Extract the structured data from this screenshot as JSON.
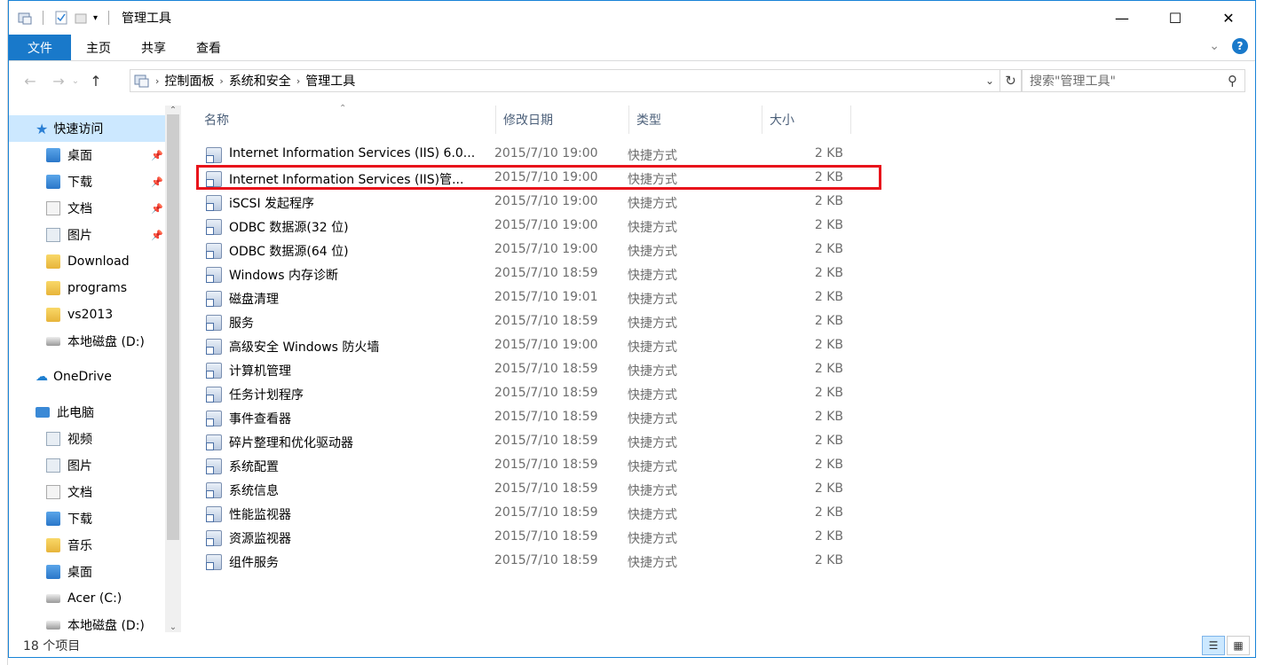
{
  "title": "管理工具",
  "ribbon": {
    "tabs": [
      "文件",
      "主页",
      "共享",
      "查看"
    ],
    "help_label": "?"
  },
  "address": {
    "crumbs": [
      "控制面板",
      "系统和安全",
      "管理工具"
    ]
  },
  "search": {
    "placeholder": "搜索\"管理工具\""
  },
  "nav": {
    "quick_access": "快速访问",
    "items": [
      {
        "label": "桌面",
        "pinned": true,
        "icon": "desktop-folder-icon"
      },
      {
        "label": "下载",
        "pinned": true,
        "icon": "downloads-folder-icon"
      },
      {
        "label": "文档",
        "pinned": true,
        "icon": "documents-folder-icon"
      },
      {
        "label": "图片",
        "pinned": true,
        "icon": "pictures-folder-icon"
      },
      {
        "label": "Download",
        "pinned": false,
        "icon": "folder-icon"
      },
      {
        "label": "programs",
        "pinned": false,
        "icon": "folder-icon"
      },
      {
        "label": "vs2013",
        "pinned": false,
        "icon": "folder-icon"
      },
      {
        "label": "本地磁盘 (D:)",
        "pinned": false,
        "icon": "drive-icon"
      }
    ],
    "onedrive": "OneDrive",
    "this_pc": "此电脑",
    "pc_items": [
      {
        "label": "视频",
        "icon": "videos-folder-icon"
      },
      {
        "label": "图片",
        "icon": "pictures-folder-icon"
      },
      {
        "label": "文档",
        "icon": "documents-folder-icon"
      },
      {
        "label": "下载",
        "icon": "downloads-folder-icon"
      },
      {
        "label": "音乐",
        "icon": "music-folder-icon"
      },
      {
        "label": "桌面",
        "icon": "desktop-folder-icon"
      },
      {
        "label": "Acer (C:)",
        "icon": "drive-icon"
      },
      {
        "label": "本地磁盘 (D:)",
        "icon": "drive-icon"
      }
    ]
  },
  "columns": {
    "name": "名称",
    "date": "修改日期",
    "type": "类型",
    "size": "大小"
  },
  "files": [
    {
      "name": "Internet Information Services (IIS) 6.0...",
      "date": "2015/7/10 19:00",
      "type": "快捷方式",
      "size": "2 KB"
    },
    {
      "name": "Internet Information Services (IIS)管...",
      "date": "2015/7/10 19:00",
      "type": "快捷方式",
      "size": "2 KB"
    },
    {
      "name": "iSCSI 发起程序",
      "date": "2015/7/10 19:00",
      "type": "快捷方式",
      "size": "2 KB"
    },
    {
      "name": "ODBC 数据源(32 位)",
      "date": "2015/7/10 19:00",
      "type": "快捷方式",
      "size": "2 KB"
    },
    {
      "name": "ODBC 数据源(64 位)",
      "date": "2015/7/10 19:00",
      "type": "快捷方式",
      "size": "2 KB"
    },
    {
      "name": "Windows 内存诊断",
      "date": "2015/7/10 18:59",
      "type": "快捷方式",
      "size": "2 KB"
    },
    {
      "name": "磁盘清理",
      "date": "2015/7/10 19:01",
      "type": "快捷方式",
      "size": "2 KB"
    },
    {
      "name": "服务",
      "date": "2015/7/10 18:59",
      "type": "快捷方式",
      "size": "2 KB"
    },
    {
      "name": "高级安全 Windows 防火墙",
      "date": "2015/7/10 19:00",
      "type": "快捷方式",
      "size": "2 KB"
    },
    {
      "name": "计算机管理",
      "date": "2015/7/10 18:59",
      "type": "快捷方式",
      "size": "2 KB"
    },
    {
      "name": "任务计划程序",
      "date": "2015/7/10 18:59",
      "type": "快捷方式",
      "size": "2 KB"
    },
    {
      "name": "事件查看器",
      "date": "2015/7/10 18:59",
      "type": "快捷方式",
      "size": "2 KB"
    },
    {
      "name": "碎片整理和优化驱动器",
      "date": "2015/7/10 18:59",
      "type": "快捷方式",
      "size": "2 KB"
    },
    {
      "name": "系统配置",
      "date": "2015/7/10 18:59",
      "type": "快捷方式",
      "size": "2 KB"
    },
    {
      "name": "系统信息",
      "date": "2015/7/10 18:59",
      "type": "快捷方式",
      "size": "2 KB"
    },
    {
      "name": "性能监视器",
      "date": "2015/7/10 18:59",
      "type": "快捷方式",
      "size": "2 KB"
    },
    {
      "name": "资源监视器",
      "date": "2015/7/10 18:59",
      "type": "快捷方式",
      "size": "2 KB"
    },
    {
      "name": "组件服务",
      "date": "2015/7/10 18:59",
      "type": "快捷方式",
      "size": "2 KB"
    }
  ],
  "status": {
    "item_count": "18 个项目"
  },
  "colors": {
    "accent": "#1979ca",
    "highlight_box": "#e8141b",
    "selected_nav": "#cce8ff"
  }
}
